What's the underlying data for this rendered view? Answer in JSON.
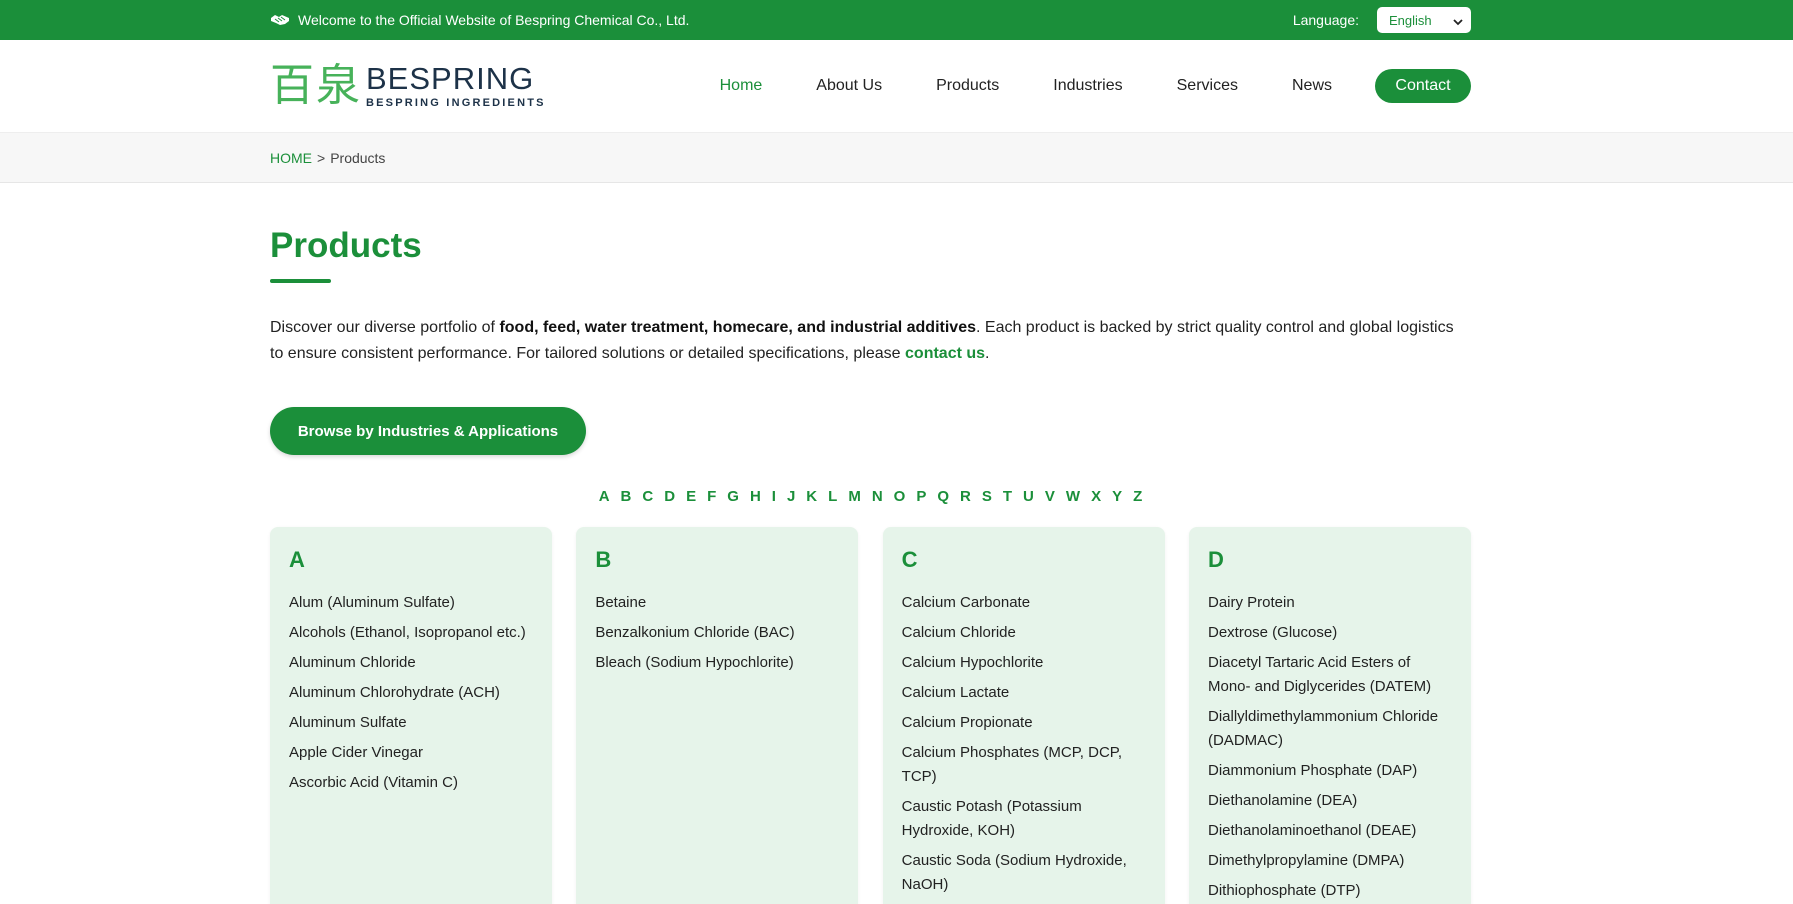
{
  "topbar": {
    "welcome": "Welcome to the Official Website of Bespring Chemical Co., Ltd.",
    "language_label": "Language:",
    "language_value": "English"
  },
  "logo": {
    "cn": "百泉",
    "en": "BESPRING",
    "sub": "BESPRING INGREDIENTS"
  },
  "nav": {
    "items": [
      "Home",
      "About Us",
      "Products",
      "Industries",
      "Services",
      "News"
    ],
    "contact": "Contact"
  },
  "breadcrumb": {
    "home": "HOME",
    "separator": ">",
    "current": "Products"
  },
  "main": {
    "title": "Products",
    "intro_1": "Discover our diverse portfolio of ",
    "intro_bold": "food, feed, water treatment, homecare, and industrial additives",
    "intro_2": ". Each product is backed by strict quality control and global logistics to ensure consistent performance. For tailored solutions or detailed specifications, please ",
    "intro_link": "contact us",
    "intro_3": ".",
    "browse_button": "Browse by Industries & Applications"
  },
  "alphabet": [
    "A",
    "B",
    "C",
    "D",
    "E",
    "F",
    "G",
    "H",
    "I",
    "J",
    "K",
    "L",
    "M",
    "N",
    "O",
    "P",
    "Q",
    "R",
    "S",
    "T",
    "U",
    "V",
    "W",
    "X",
    "Y",
    "Z"
  ],
  "cards": [
    {
      "letter": "A",
      "items": [
        "Alum (Aluminum Sulfate)",
        "Alcohols (Ethanol, Isopropanol etc.)",
        "Aluminum Chloride",
        "Aluminum Chlorohydrate (ACH)",
        "Aluminum Sulfate",
        "Apple Cider Vinegar",
        "Ascorbic Acid (Vitamin C)"
      ]
    },
    {
      "letter": "B",
      "items": [
        "Betaine",
        "Benzalkonium Chloride (BAC)",
        "Bleach (Sodium Hypochlorite)"
      ]
    },
    {
      "letter": "C",
      "items": [
        "Calcium Carbonate",
        "Calcium Chloride",
        "Calcium Hypochlorite",
        "Calcium Lactate",
        "Calcium Propionate",
        "Calcium Phosphates (MCP, DCP, TCP)",
        "Caustic Potash (Potassium Hydroxide, KOH)",
        "Caustic Soda (Sodium Hydroxide, NaOH)"
      ]
    },
    {
      "letter": "D",
      "items": [
        "Dairy Protein",
        "Dextrose (Glucose)",
        "Diacetyl Tartaric Acid Esters of Mono- and Diglycerides (DATEM)",
        "Diallyldimethylammonium Chloride (DADMAC)",
        "Diammonium Phosphate (DAP)",
        "Diethanolamine (DEA)",
        "Diethanolaminoethanol (DEAE)",
        "Dimethylpropylamine (DMPA)",
        "Dithiophosphate (DTP)"
      ]
    }
  ],
  "colors": {
    "brand_green": "#1b8f3a",
    "card_bg": "#e6f4ea",
    "logo_green": "#47b25a"
  }
}
